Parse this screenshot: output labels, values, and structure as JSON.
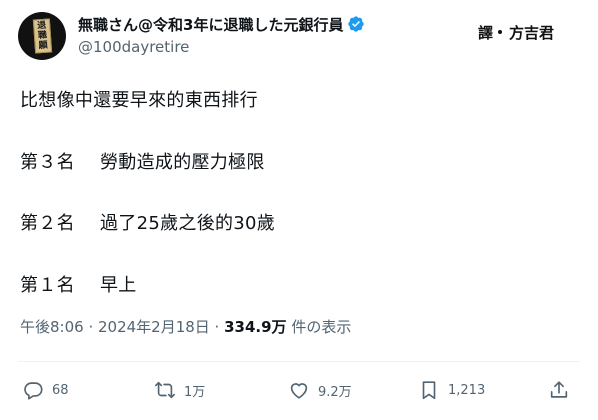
{
  "author": {
    "display_name": "無職さん@令和3年に退職した元銀行員",
    "handle": "@100dayretire",
    "avatar_text": [
      "退",
      "職",
      "願"
    ]
  },
  "translator": {
    "label": "譯",
    "name": "方吉君"
  },
  "tweet": {
    "title": "比想像中還要早來的東西排行",
    "ranks": [
      {
        "label": "第３名",
        "text": "勞動造成的壓力極限"
      },
      {
        "label": "第２名",
        "text": "過了25歲之後的30歲"
      },
      {
        "label": "第１名",
        "text": "早上"
      }
    ]
  },
  "meta": {
    "time": "午後8:06 · 2024年2月18日 · ",
    "views": "334.9万",
    "views_suffix": " 件の表示"
  },
  "actions": {
    "replies": "68",
    "reposts": "1万",
    "likes": "9.2万",
    "bookmarks": "1,213"
  },
  "colors": {
    "verified": "#1d9bf0",
    "text": "#0f1419",
    "muted": "#536471"
  }
}
